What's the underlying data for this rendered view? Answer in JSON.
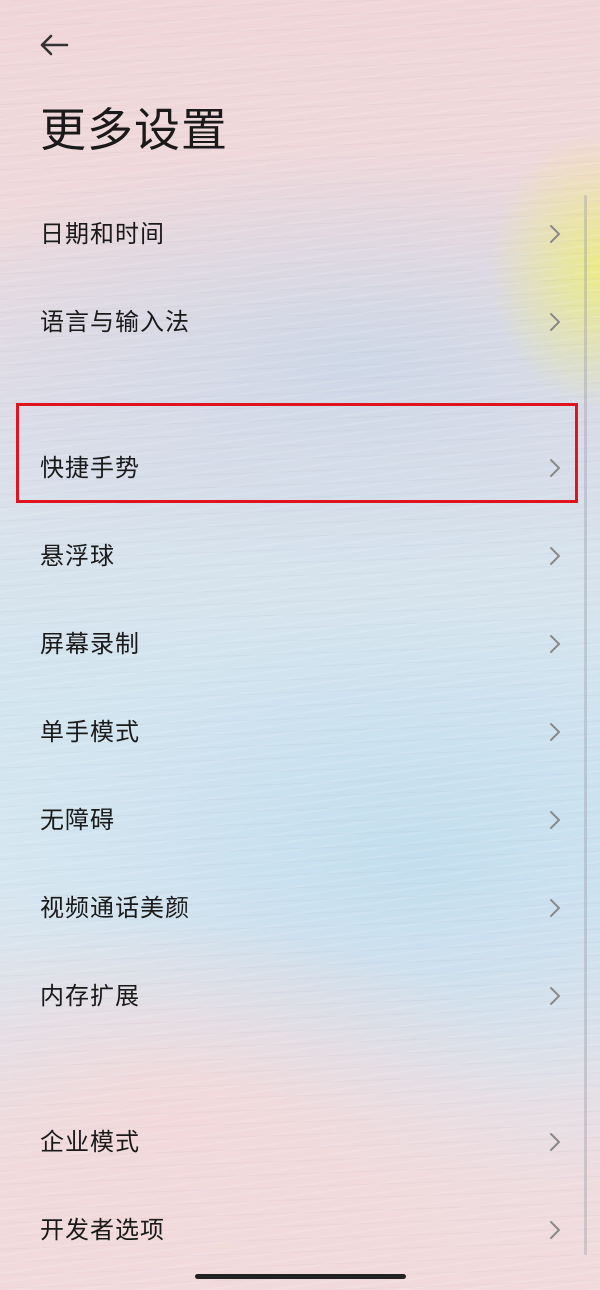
{
  "header": {
    "back_icon": "arrow-left-icon",
    "title": "更多设置"
  },
  "settings": {
    "items": [
      {
        "label": "日期和时间"
      },
      {
        "label": "语言与输入法"
      },
      {
        "label": "快捷手势",
        "highlighted": true
      },
      {
        "label": "悬浮球"
      },
      {
        "label": "屏幕录制"
      },
      {
        "label": "单手模式"
      },
      {
        "label": "无障碍"
      },
      {
        "label": "视频通话美颜"
      },
      {
        "label": "内存扩展"
      },
      {
        "label": "企业模式"
      },
      {
        "label": "开发者选项"
      }
    ],
    "chevron_icon": "chevron-right-icon"
  },
  "colors": {
    "highlight_border": "#e0141e",
    "text": "#1a1a1a",
    "chevron": "#8a8a8a"
  }
}
